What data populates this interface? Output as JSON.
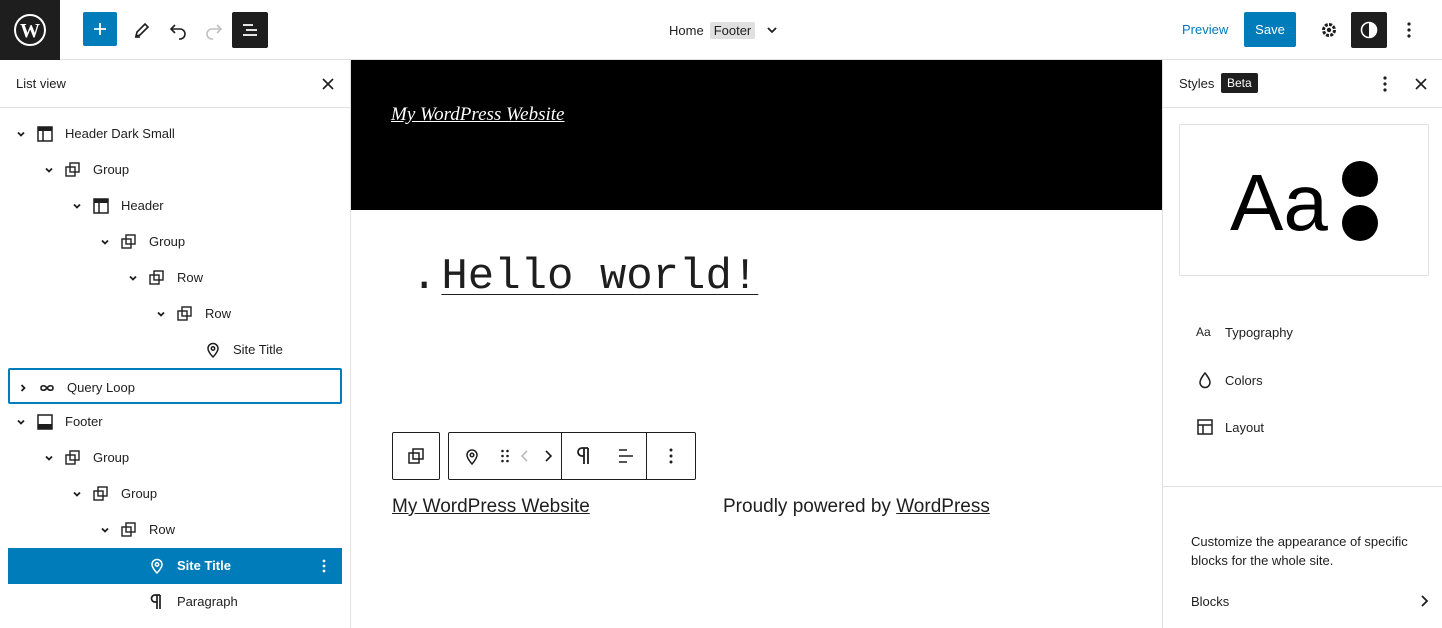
{
  "topbar": {
    "doc_title": "Home",
    "doc_badge": "Footer",
    "preview_label": "Preview",
    "save_label": "Save"
  },
  "list_view": {
    "title": "List view",
    "items": [
      {
        "label": "Header Dark Small",
        "icon": "template-part-icon",
        "level": 0,
        "expanded": true
      },
      {
        "label": "Group",
        "icon": "group-icon",
        "level": 1,
        "expanded": true
      },
      {
        "label": "Header",
        "icon": "template-part-icon",
        "level": 2,
        "expanded": true
      },
      {
        "label": "Group",
        "icon": "group-icon",
        "level": 3,
        "expanded": true
      },
      {
        "label": "Row",
        "icon": "group-icon",
        "level": 4,
        "expanded": true
      },
      {
        "label": "Row",
        "icon": "group-icon",
        "level": 5,
        "expanded": true
      },
      {
        "label": "Site Title",
        "icon": "map-marker-icon",
        "level": 6,
        "expanded": null
      },
      {
        "label": "Query Loop",
        "icon": "loop-icon",
        "level": 0,
        "expanded": false
      },
      {
        "label": "Footer",
        "icon": "footer-icon",
        "level": 0,
        "expanded": true
      },
      {
        "label": "Group",
        "icon": "group-icon",
        "level": 1,
        "expanded": true
      },
      {
        "label": "Group",
        "icon": "group-icon",
        "level": 2,
        "expanded": true
      },
      {
        "label": "Row",
        "icon": "group-icon",
        "level": 3,
        "expanded": true
      },
      {
        "label": "Site Title",
        "icon": "map-marker-icon",
        "level": 4,
        "expanded": null
      },
      {
        "label": "Paragraph",
        "icon": "paragraph-icon",
        "level": 4,
        "expanded": null
      }
    ]
  },
  "canvas": {
    "header_site_title": "My WordPress Website",
    "post_bullet": ".",
    "post_title": "Hello world!",
    "footer_site_title": "My WordPress Website",
    "footer_credit_prefix": "Proudly powered by ",
    "footer_credit_link": "WordPress"
  },
  "styles_panel": {
    "title": "Styles",
    "badge": "Beta",
    "preview_text": "Aa",
    "nav": [
      {
        "label": "Typography",
        "icon": "typography-icon"
      },
      {
        "label": "Colors",
        "icon": "color-drop-icon"
      },
      {
        "label": "Layout",
        "icon": "layout-icon"
      }
    ],
    "description": "Customize the appearance of specific blocks for the whole site.",
    "blocks_label": "Blocks"
  },
  "colors": {
    "accent": "#007cba",
    "dark": "#1e1e1e",
    "border": "#e0e0e0"
  }
}
